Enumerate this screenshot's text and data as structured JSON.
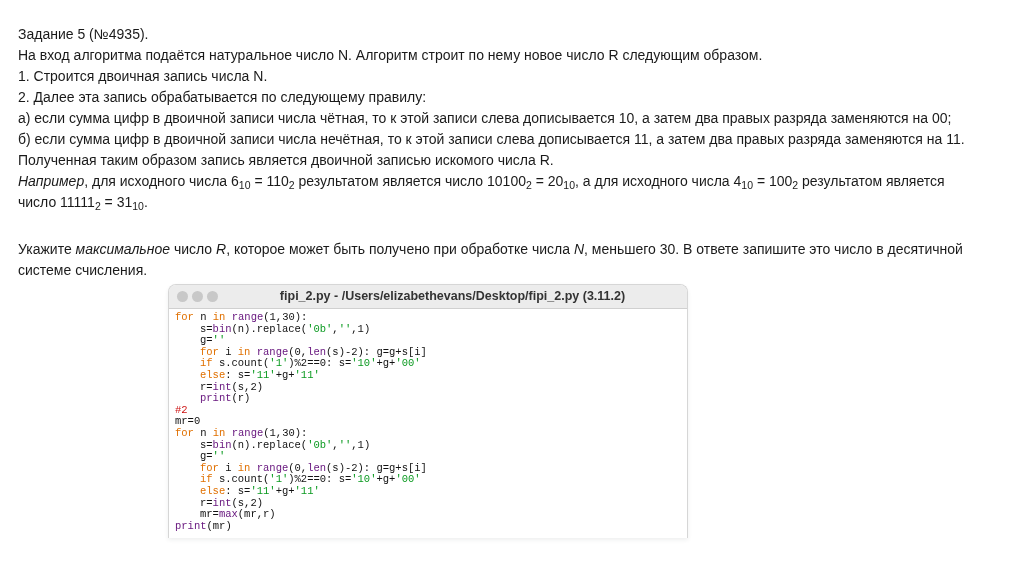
{
  "task": {
    "title": "Задание 5 (№4935).",
    "lines": [
      "На вход алгоритма подаётся натуральное число N. Алгоритм строит по нему новое число R следующим образом.",
      "1. Строится двоичная запись числа N.",
      "2. Далее эта запись обрабатывается по следующему правилу:",
      "а) если сумма цифр в двоичной записи числа чётная, то к этой записи слева дописывается 10, а затем два правых разряда заменяются на 00;",
      "б) если сумма цифр в двоичной записи числа нечётная, то к этой записи слева дописывается 11, а затем два правых разряда заменяются на 11.",
      "Полученная таким образом запись является двоичной записью искомого числа R.",
      "*Например*, для исходного числа 6$_{10}$ = 110$_{2}$ результатом является число 10100$_{2}$ = 20$_{10}$, а для исходного числа 4$_{10}$ = 100$_{2}$ результатом является число 11111$_{2}$ = 31$_{10}$."
    ],
    "question": "Укажите *максимальное* число *R*, которое может быть получено при обработке числа *N*, меньшего 30. В ответе запишите это число в десятичной системе счисления."
  },
  "editor": {
    "title": "fipi_2.py - /Users/elizabethevans/Desktop/fipi_2.py (3.11.2)",
    "code": [
      {
        "tokens": [
          {
            "kind": "keyword",
            "text": "for"
          },
          {
            "kind": "plain",
            "text": " n "
          },
          {
            "kind": "keyword",
            "text": "in"
          },
          {
            "kind": "builtin",
            "text": " range"
          },
          {
            "kind": "plain",
            "text": "(1,30):"
          }
        ],
        "children": [
          {
            "tokens": [
              {
                "kind": "plain",
                "text": "s="
              },
              {
                "kind": "builtin",
                "text": "bin"
              },
              {
                "kind": "plain",
                "text": "(n).replace("
              },
              {
                "kind": "string",
                "text": "'0b'"
              },
              {
                "kind": "plain",
                "text": ","
              },
              {
                "kind": "string",
                "text": "''"
              },
              {
                "kind": "plain",
                "text": ",1)"
              }
            ]
          },
          {
            "tokens": [
              {
                "kind": "plain",
                "text": "g="
              },
              {
                "kind": "string",
                "text": "''"
              }
            ]
          },
          {
            "tokens": [
              {
                "kind": "keyword",
                "text": "for"
              },
              {
                "kind": "plain",
                "text": " i "
              },
              {
                "kind": "keyword",
                "text": "in"
              },
              {
                "kind": "builtin",
                "text": " range"
              },
              {
                "kind": "plain",
                "text": "(0,"
              },
              {
                "kind": "builtin",
                "text": "len"
              },
              {
                "kind": "plain",
                "text": "(s)-2): g=g+s[i]"
              }
            ]
          },
          {
            "tokens": [
              {
                "kind": "keyword",
                "text": "if"
              },
              {
                "kind": "plain",
                "text": " s.count("
              },
              {
                "kind": "string",
                "text": "'1'"
              },
              {
                "kind": "plain",
                "text": ")%2==0: s="
              },
              {
                "kind": "string",
                "text": "'10'"
              },
              {
                "kind": "plain",
                "text": "+g+"
              },
              {
                "kind": "string",
                "text": "'00'"
              }
            ]
          },
          {
            "tokens": [
              {
                "kind": "keyword",
                "text": "else"
              },
              {
                "kind": "plain",
                "text": ": s="
              },
              {
                "kind": "string",
                "text": "'11'"
              },
              {
                "kind": "plain",
                "text": "+g+"
              },
              {
                "kind": "string",
                "text": "'11'"
              }
            ]
          },
          {
            "tokens": [
              {
                "kind": "plain",
                "text": "r="
              },
              {
                "kind": "builtin",
                "text": "int"
              },
              {
                "kind": "plain",
                "text": "(s,2)"
              }
            ]
          },
          {
            "tokens": [
              {
                "kind": "builtin",
                "text": "print"
              },
              {
                "kind": "plain",
                "text": "(r)"
              }
            ]
          }
        ]
      },
      {
        "tokens": [
          {
            "kind": "comment",
            "text": "#2"
          }
        ]
      },
      {
        "tokens": [
          {
            "kind": "plain",
            "text": "mr=0"
          }
        ]
      },
      {
        "tokens": [
          {
            "kind": "keyword",
            "text": "for"
          },
          {
            "kind": "plain",
            "text": " n "
          },
          {
            "kind": "keyword",
            "text": "in"
          },
          {
            "kind": "builtin",
            "text": " range"
          },
          {
            "kind": "plain",
            "text": "(1,30):"
          }
        ],
        "children": [
          {
            "tokens": [
              {
                "kind": "plain",
                "text": "s="
              },
              {
                "kind": "builtin",
                "text": "bin"
              },
              {
                "kind": "plain",
                "text": "(n).replace("
              },
              {
                "kind": "string",
                "text": "'0b'"
              },
              {
                "kind": "plain",
                "text": ","
              },
              {
                "kind": "string",
                "text": "''"
              },
              {
                "kind": "plain",
                "text": ",1)"
              }
            ]
          },
          {
            "tokens": [
              {
                "kind": "plain",
                "text": "g="
              },
              {
                "kind": "string",
                "text": "''"
              }
            ]
          },
          {
            "tokens": [
              {
                "kind": "keyword",
                "text": "for"
              },
              {
                "kind": "plain",
                "text": " i "
              },
              {
                "kind": "keyword",
                "text": "in"
              },
              {
                "kind": "builtin",
                "text": " range"
              },
              {
                "kind": "plain",
                "text": "(0,"
              },
              {
                "kind": "builtin",
                "text": "len"
              },
              {
                "kind": "plain",
                "text": "(s)-2): g=g+s[i]"
              }
            ]
          },
          {
            "tokens": [
              {
                "kind": "keyword",
                "text": "if"
              },
              {
                "kind": "plain",
                "text": " s.count("
              },
              {
                "kind": "string",
                "text": "'1'"
              },
              {
                "kind": "plain",
                "text": ")%2==0: s="
              },
              {
                "kind": "string",
                "text": "'10'"
              },
              {
                "kind": "plain",
                "text": "+g+"
              },
              {
                "kind": "string",
                "text": "'00'"
              }
            ]
          },
          {
            "tokens": [
              {
                "kind": "keyword",
                "text": "else"
              },
              {
                "kind": "plain",
                "text": ": s="
              },
              {
                "kind": "string",
                "text": "'11'"
              },
              {
                "kind": "plain",
                "text": "+g+"
              },
              {
                "kind": "string",
                "text": "'11'"
              }
            ]
          },
          {
            "tokens": [
              {
                "kind": "plain",
                "text": "r="
              },
              {
                "kind": "builtin",
                "text": "int"
              },
              {
                "kind": "plain",
                "text": "(s,2)"
              }
            ]
          },
          {
            "tokens": [
              {
                "kind": "plain",
                "text": "mr="
              },
              {
                "kind": "builtin",
                "text": "max"
              },
              {
                "kind": "plain",
                "text": "(mr,r)"
              }
            ]
          }
        ]
      },
      {
        "tokens": [
          {
            "kind": "builtin",
            "text": "print"
          },
          {
            "kind": "plain",
            "text": "(mr)"
          }
        ]
      }
    ]
  }
}
